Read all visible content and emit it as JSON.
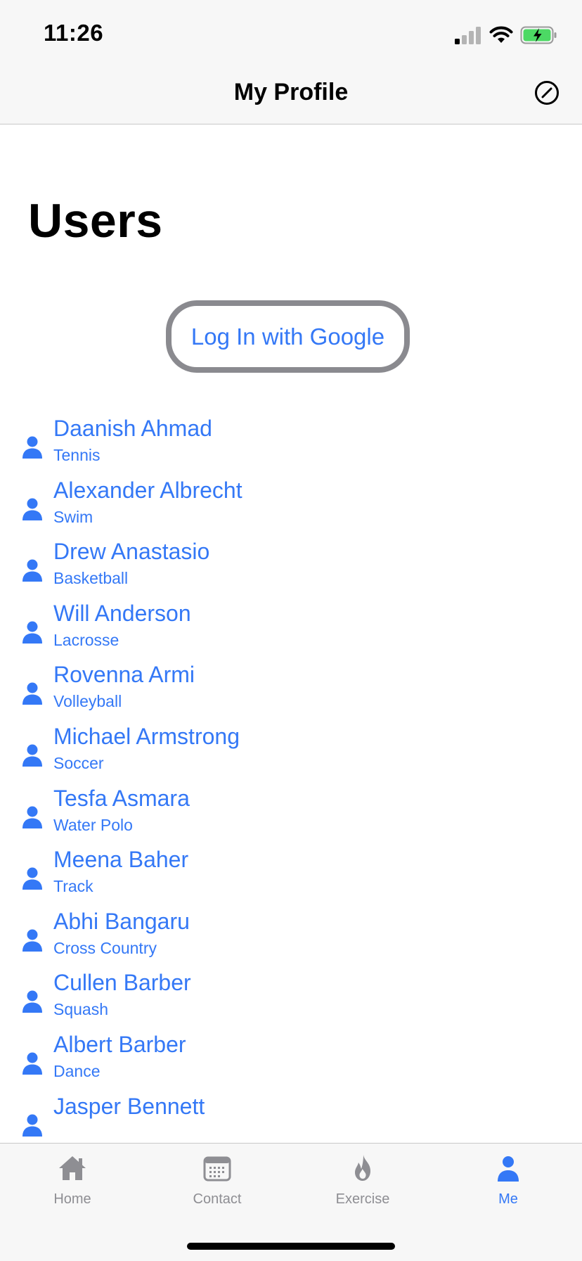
{
  "status": {
    "time": "11:26"
  },
  "nav": {
    "title": "My Profile"
  },
  "page": {
    "title": "Users",
    "google_button": "Log In with Google"
  },
  "users": [
    {
      "name": "Daanish Ahmad",
      "sport": "Tennis"
    },
    {
      "name": "Alexander Albrecht",
      "sport": "Swim"
    },
    {
      "name": "Drew Anastasio",
      "sport": "Basketball"
    },
    {
      "name": "Will Anderson",
      "sport": "Lacrosse"
    },
    {
      "name": "Rovenna Armi",
      "sport": "Volleyball"
    },
    {
      "name": "Michael Armstrong",
      "sport": "Soccer"
    },
    {
      "name": "Tesfa Asmara",
      "sport": "Water Polo"
    },
    {
      "name": "Meena Baher",
      "sport": "Track"
    },
    {
      "name": "Abhi Bangaru",
      "sport": "Cross Country"
    },
    {
      "name": "Cullen Barber",
      "sport": "Squash"
    },
    {
      "name": "Albert Barber",
      "sport": "Dance"
    },
    {
      "name": "Jasper Bennett",
      "sport": ""
    }
  ],
  "tabs": [
    {
      "label": "Home",
      "icon": "home-icon",
      "active": false
    },
    {
      "label": "Contact",
      "icon": "calendar-icon",
      "active": false
    },
    {
      "label": "Exercise",
      "icon": "flame-icon",
      "active": false
    },
    {
      "label": "Me",
      "icon": "person-icon",
      "active": true
    }
  ],
  "colors": {
    "accent": "#3478f6",
    "inactive": "#8e8e93",
    "battery": "#4cd964"
  }
}
